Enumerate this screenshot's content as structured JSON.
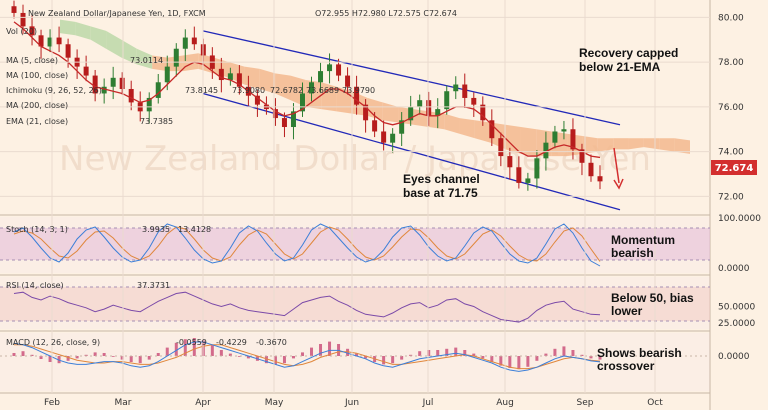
{
  "header": {
    "title": "New Zealand Dollar/Japanese Yen, 1D, FXCM",
    "ohlc": "O72.955  H72.980  L72.575  C72.674"
  },
  "price_label": "72.674",
  "colors": {
    "up": "#2e7d32",
    "down": "#b71c1c",
    "ema": "#c62828",
    "channel": "#2229b8",
    "cloud_bear": "#f3b88e",
    "cloud_bull": "#bcd8a8",
    "stoch_k": "#3c7fd8",
    "stoch_d": "#e0873c",
    "rsi": "#7b4aa8",
    "macd_line": "#3c7fd8",
    "signal_line": "#e0873c",
    "hist": "#d36a8b",
    "watermark": "#e8cdb9"
  },
  "indicators": {
    "vol": "Vol (20)",
    "ma5": "MA (5, close)",
    "ma5_val": "73.0114",
    "ma100": "MA (100, close)",
    "ichimoku": "Ichimoku (9, 26, 52, 26)",
    "ichi_vals": [
      "73.8145",
      "73.9080",
      "72.6782",
      "73.6689",
      "73.9790"
    ],
    "ma200": "MA (200, close)",
    "ema21": "EMA (21, close)",
    "ema21_val": "73.7385"
  },
  "watermark": "New Zealand Dollar / Japanese Yen",
  "annotations": {
    "recovery": [
      "Recovery capped",
      "below 21-EMA"
    ],
    "channel": [
      "Eyes channel",
      "base at 71.75"
    ],
    "momentum": [
      "Momentum",
      "bearish"
    ],
    "rsi": [
      "Below 50, bias",
      "lower"
    ],
    "macd": [
      "Shows bearish",
      "crossover"
    ]
  },
  "chart_data": [
    {
      "type": "candlestick",
      "title": "New Zealand Dollar/Japanese Yen, 1D, FXCM",
      "x": [
        "Feb",
        "Mar",
        "Apr",
        "May",
        "Jun",
        "Jul",
        "Aug",
        "Sep",
        "Oct"
      ],
      "y_ticks": [
        72.0,
        74.0,
        76.0,
        78.0,
        80.0
      ],
      "ylim": [
        71.3,
        80.6
      ],
      "last": {
        "open": 72.955,
        "high": 72.98,
        "low": 72.575,
        "close": 72.674
      },
      "close_path": [
        80.2,
        79.6,
        79.2,
        78.7,
        79.1,
        78.8,
        78.2,
        77.8,
        77.4,
        76.6,
        76.9,
        77.3,
        76.8,
        76.2,
        75.8,
        76.4,
        77.1,
        77.8,
        78.6,
        79.1,
        78.8,
        78.3,
        77.7,
        77.2,
        77.5,
        76.9,
        76.5,
        76.1,
        75.9,
        75.5,
        75.1,
        75.8,
        76.6,
        77.1,
        77.6,
        77.9,
        77.4,
        76.9,
        76.1,
        75.4,
        74.9,
        74.4,
        74.8,
        75.4,
        76.0,
        76.3,
        75.6,
        75.9,
        76.7,
        77.0,
        76.4,
        76.1,
        75.4,
        74.6,
        73.8,
        73.3,
        72.6,
        72.8,
        73.7,
        74.4,
        74.9,
        75.0,
        74.1,
        73.5,
        72.9,
        72.67
      ],
      "ema21_path": [
        79.8,
        79.5,
        79.1,
        78.7,
        78.5,
        78.3,
        78.0,
        77.6,
        77.2,
        76.9,
        76.8,
        76.7,
        76.6,
        76.4,
        76.2,
        76.3,
        76.6,
        77.0,
        77.4,
        77.8,
        78.0,
        77.9,
        77.6,
        77.3,
        77.2,
        77.0,
        76.7,
        76.4,
        76.1,
        75.8,
        75.6,
        75.7,
        75.9,
        76.2,
        76.5,
        76.8,
        76.8,
        76.6,
        76.3,
        76.0,
        75.6,
        75.3,
        75.2,
        75.3,
        75.5,
        75.7,
        75.6,
        75.6,
        75.8,
        76.0,
        76.0,
        75.9,
        75.6,
        75.2,
        74.8,
        74.4,
        74.0,
        73.8,
        73.8,
        74.0,
        74.2,
        74.3,
        74.2,
        74.0,
        73.8,
        73.74
      ],
      "cloud_top_path": [
        79.9,
        79.8,
        79.6,
        79.4,
        79.0,
        78.6,
        78.3,
        78.2,
        78.3,
        78.4,
        78.2,
        78.0,
        77.8,
        77.7,
        77.5,
        77.4,
        77.2,
        77.1,
        76.9,
        76.7,
        76.4,
        76.2,
        76.0,
        75.9,
        75.8,
        75.7,
        75.5,
        75.4,
        75.3,
        75.2,
        75.1,
        75.0,
        74.9,
        74.8,
        74.7,
        74.6,
        74.6,
        74.6,
        74.6,
        74.6,
        74.6,
        74.5
      ],
      "cloud_bot_path": [
        79.3,
        79.2,
        79.0,
        78.6,
        78.2,
        77.9,
        77.7,
        77.6,
        77.6,
        77.7,
        77.5,
        77.3,
        77.0,
        76.8,
        76.6,
        76.3,
        76.0,
        75.9,
        75.8,
        75.7,
        75.6,
        75.4,
        75.3,
        75.2,
        75.1,
        75.0,
        74.8,
        74.6,
        74.4,
        74.1,
        73.9,
        73.8,
        73.8,
        73.8,
        73.9,
        74.0,
        74.1,
        74.1,
        74.2,
        74.1,
        74.0,
        73.9
      ],
      "channel_upper": [
        {
          "x": "Apr",
          "y": 79.4
        },
        {
          "x": "Sep",
          "y": 75.2
        }
      ],
      "channel_lower": [
        {
          "x": "Apr",
          "y": 76.6
        },
        {
          "x": "Sep",
          "y": 71.4
        }
      ],
      "series": [
        {
          "name": "MA (5, close)",
          "last": 73.0114
        },
        {
          "name": "EMA (21, close)",
          "last": 73.7385
        }
      ]
    },
    {
      "type": "line",
      "title": "Stoch (14, 3, 1)",
      "y_ticks": [
        0.0,
        100.0
      ],
      "ylim": [
        0,
        100
      ],
      "series": [
        {
          "name": "%K",
          "last": 3.9935,
          "values": [
            72,
            80,
            62,
            40,
            20,
            12,
            30,
            58,
            76,
            82,
            62,
            40,
            22,
            12,
            16,
            40,
            72,
            88,
            82,
            60,
            36,
            18,
            10,
            14,
            40,
            70,
            84,
            74,
            50,
            28,
            14,
            20,
            46,
            76,
            88,
            80,
            60,
            40,
            22,
            12,
            18,
            36,
            62,
            80,
            84,
            66,
            42,
            24,
            14,
            20,
            44,
            70,
            82,
            74,
            50,
            28,
            14,
            10,
            20,
            48,
            78,
            88,
            70,
            40,
            14,
            4
          ]
        },
        {
          "name": "%D",
          "last": 13.4128,
          "values": [
            68,
            74,
            70,
            58,
            40,
            24,
            20,
            34,
            56,
            72,
            74,
            60,
            40,
            24,
            16,
            24,
            44,
            68,
            82,
            78,
            58,
            36,
            20,
            14,
            22,
            46,
            66,
            76,
            68,
            48,
            28,
            18,
            28,
            50,
            72,
            82,
            76,
            58,
            38,
            22,
            16,
            24,
            42,
            62,
            78,
            76,
            60,
            40,
            24,
            18,
            28,
            48,
            68,
            76,
            64,
            44,
            26,
            16,
            14,
            28,
            52,
            74,
            80,
            64,
            38,
            13
          ]
        }
      ]
    },
    {
      "type": "line",
      "title": "RSI (14, close)",
      "y_ticks": [
        25.0,
        50.0
      ],
      "ylim": [
        20,
        85
      ],
      "series": [
        {
          "name": "RSI",
          "last": 37.3731,
          "values": [
            70,
            72,
            64,
            60,
            66,
            62,
            56,
            52,
            48,
            42,
            46,
            52,
            48,
            44,
            42,
            50,
            58,
            64,
            70,
            72,
            66,
            60,
            54,
            50,
            54,
            48,
            44,
            42,
            40,
            38,
            36,
            46,
            56,
            60,
            64,
            66,
            58,
            52,
            44,
            38,
            36,
            34,
            40,
            48,
            54,
            56,
            48,
            52,
            60,
            62,
            54,
            50,
            42,
            36,
            30,
            28,
            26,
            32,
            44,
            52,
            56,
            58,
            46,
            42,
            38,
            37.4
          ]
        }
      ]
    },
    {
      "type": "bar",
      "title": "MACD (12, 26, close, 9)",
      "y_ticks": [
        0.0
      ],
      "ylim": [
        -1.3,
        1.3
      ],
      "series": [
        {
          "name": "Histogram",
          "last": -0.0559,
          "values": [
            0.05,
            0.08,
            0.02,
            -0.05,
            -0.1,
            -0.12,
            -0.08,
            -0.04,
            0.02,
            0.06,
            0.05,
            0.0,
            -0.06,
            -0.1,
            -0.12,
            -0.06,
            0.05,
            0.14,
            0.22,
            0.28,
            0.3,
            0.26,
            0.18,
            0.1,
            0.04,
            0.0,
            -0.04,
            -0.08,
            -0.12,
            -0.14,
            -0.12,
            -0.04,
            0.06,
            0.14,
            0.2,
            0.24,
            0.2,
            0.12,
            0.04,
            -0.04,
            -0.1,
            -0.14,
            -0.12,
            -0.06,
            0.02,
            0.08,
            0.1,
            0.1,
            0.12,
            0.14,
            0.1,
            0.04,
            -0.04,
            -0.1,
            -0.16,
            -0.2,
            -0.22,
            -0.18,
            -0.08,
            0.04,
            0.12,
            0.16,
            0.1,
            0.02,
            -0.04,
            -0.06
          ]
        },
        {
          "name": "MACD",
          "last": -0.4229,
          "values": [
            0.9,
            0.8,
            0.6,
            0.3,
            0.0,
            -0.3,
            -0.5,
            -0.6,
            -0.6,
            -0.5,
            -0.4,
            -0.4,
            -0.5,
            -0.7,
            -0.8,
            -0.7,
            -0.4,
            0.0,
            0.4,
            0.8,
            1.0,
            1.0,
            0.8,
            0.6,
            0.4,
            0.2,
            0.0,
            -0.2,
            -0.4,
            -0.6,
            -0.8,
            -0.7,
            -0.4,
            -0.1,
            0.2,
            0.4,
            0.4,
            0.2,
            0.0,
            -0.2,
            -0.5,
            -0.7,
            -0.8,
            -0.6,
            -0.4,
            -0.2,
            -0.1,
            0.0,
            0.1,
            0.2,
            0.1,
            -0.1,
            -0.3,
            -0.5,
            -0.8,
            -1.0,
            -1.1,
            -1.0,
            -0.8,
            -0.5,
            -0.2,
            0.0,
            -0.1,
            -0.2,
            -0.35,
            -0.42
          ]
        },
        {
          "name": "Signal",
          "last": -0.367,
          "values": [
            0.8,
            0.8,
            0.7,
            0.5,
            0.3,
            0.1,
            -0.1,
            -0.3,
            -0.4,
            -0.5,
            -0.5,
            -0.4,
            -0.4,
            -0.5,
            -0.6,
            -0.6,
            -0.5,
            -0.3,
            -0.1,
            0.2,
            0.5,
            0.7,
            0.8,
            0.8,
            0.6,
            0.4,
            0.2,
            0.0,
            -0.2,
            -0.4,
            -0.6,
            -0.7,
            -0.6,
            -0.4,
            -0.1,
            0.1,
            0.3,
            0.3,
            0.2,
            0.0,
            -0.2,
            -0.4,
            -0.6,
            -0.6,
            -0.5,
            -0.4,
            -0.3,
            -0.2,
            -0.1,
            0.0,
            0.1,
            0.0,
            -0.2,
            -0.4,
            -0.6,
            -0.8,
            -0.9,
            -0.9,
            -0.8,
            -0.6,
            -0.4,
            -0.2,
            -0.1,
            -0.2,
            -0.3,
            -0.37
          ]
        }
      ]
    }
  ]
}
